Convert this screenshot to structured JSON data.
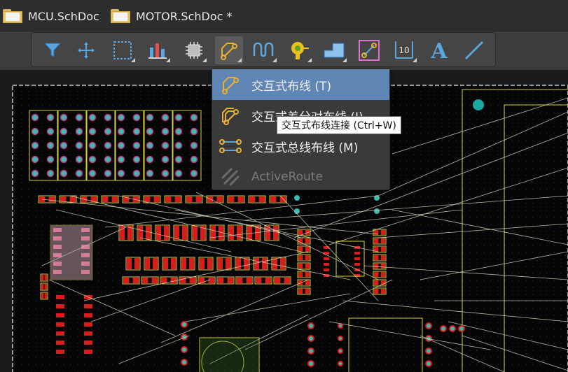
{
  "tabs": [
    {
      "label": "MCU.SchDoc",
      "icon": "folder-icon"
    },
    {
      "label": "MOTOR.SchDoc *",
      "icon": "folder-icon"
    }
  ],
  "toolbar": {
    "tools": [
      {
        "name": "filter-icon"
      },
      {
        "name": "move-icon"
      },
      {
        "name": "select-rect-icon"
      },
      {
        "name": "align-icon"
      },
      {
        "name": "component-icon"
      },
      {
        "name": "interactive-route-icon",
        "active": true
      },
      {
        "name": "length-tuning-icon"
      },
      {
        "name": "via-icon"
      },
      {
        "name": "polygon-pour-icon"
      },
      {
        "name": "diff-pair-icon"
      },
      {
        "name": "dimension-icon",
        "text": "10"
      },
      {
        "name": "text-icon",
        "text": "A"
      },
      {
        "name": "line-icon"
      }
    ]
  },
  "menu": {
    "items": [
      {
        "label": "交互式布线 (T)",
        "icon": "route-icon",
        "highlight": true,
        "disabled": false
      },
      {
        "label": "交互式差分对布线 (I)",
        "icon": "diff-route-icon",
        "highlight": false,
        "disabled": false
      },
      {
        "label": "交互式总线布线 (M)",
        "icon": "bus-route-icon",
        "highlight": false,
        "disabled": false
      },
      {
        "label": "ActiveRoute",
        "icon": "active-route-icon",
        "highlight": false,
        "disabled": true
      }
    ]
  },
  "tooltip": {
    "text": "交互式布线连接 (Ctrl+W)"
  },
  "colors": {
    "highlight": "#5f86b5",
    "board_outline": "#d8d040",
    "pad": "#d91c1c",
    "via": "#3fb8b0",
    "ratsnest": "#d8d8c0"
  }
}
